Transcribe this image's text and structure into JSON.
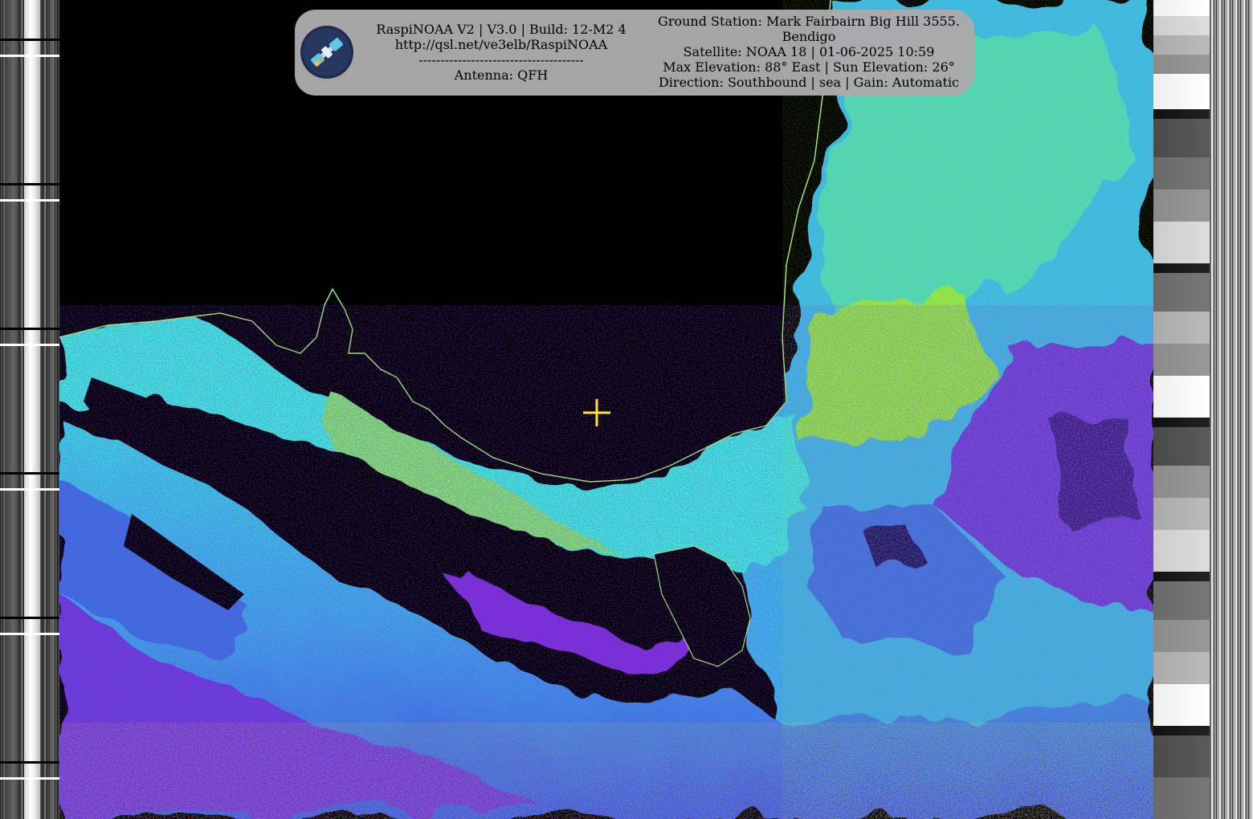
{
  "overlay": {
    "software_line": "RaspiNOAA V2 | V3.0 | Build: 12-M2 4",
    "url_line": "http://qsl.net/ve3elb/RaspiNOAA",
    "divider_line": "--------------------------------------",
    "antenna_line": "Antenna: QFH",
    "station_line_1": "Ground Station: Mark Fairbairn Big Hill 3555.",
    "station_line_2": "Bendigo",
    "satellite_line": "Satellite: NOAA 18 | 01-06-2025 10:59",
    "elevation_line": "Max Elevation: 88° East | Sun Elevation: 26°",
    "direction_line": "Direction: Southbound | sea | Gain: Automatic"
  },
  "icons": {
    "logo": "satellite-logo-icon",
    "marker": "crosshair-icon"
  },
  "colors": {
    "panel_bg": "#aaaaaa",
    "coastline": "#a8f07a",
    "crosshair": "#ffe033",
    "palette_cyan": "#3ee8d8",
    "palette_green": "#8fe04a",
    "palette_blue": "#3b6fe0",
    "palette_purple": "#7a2fd6"
  }
}
